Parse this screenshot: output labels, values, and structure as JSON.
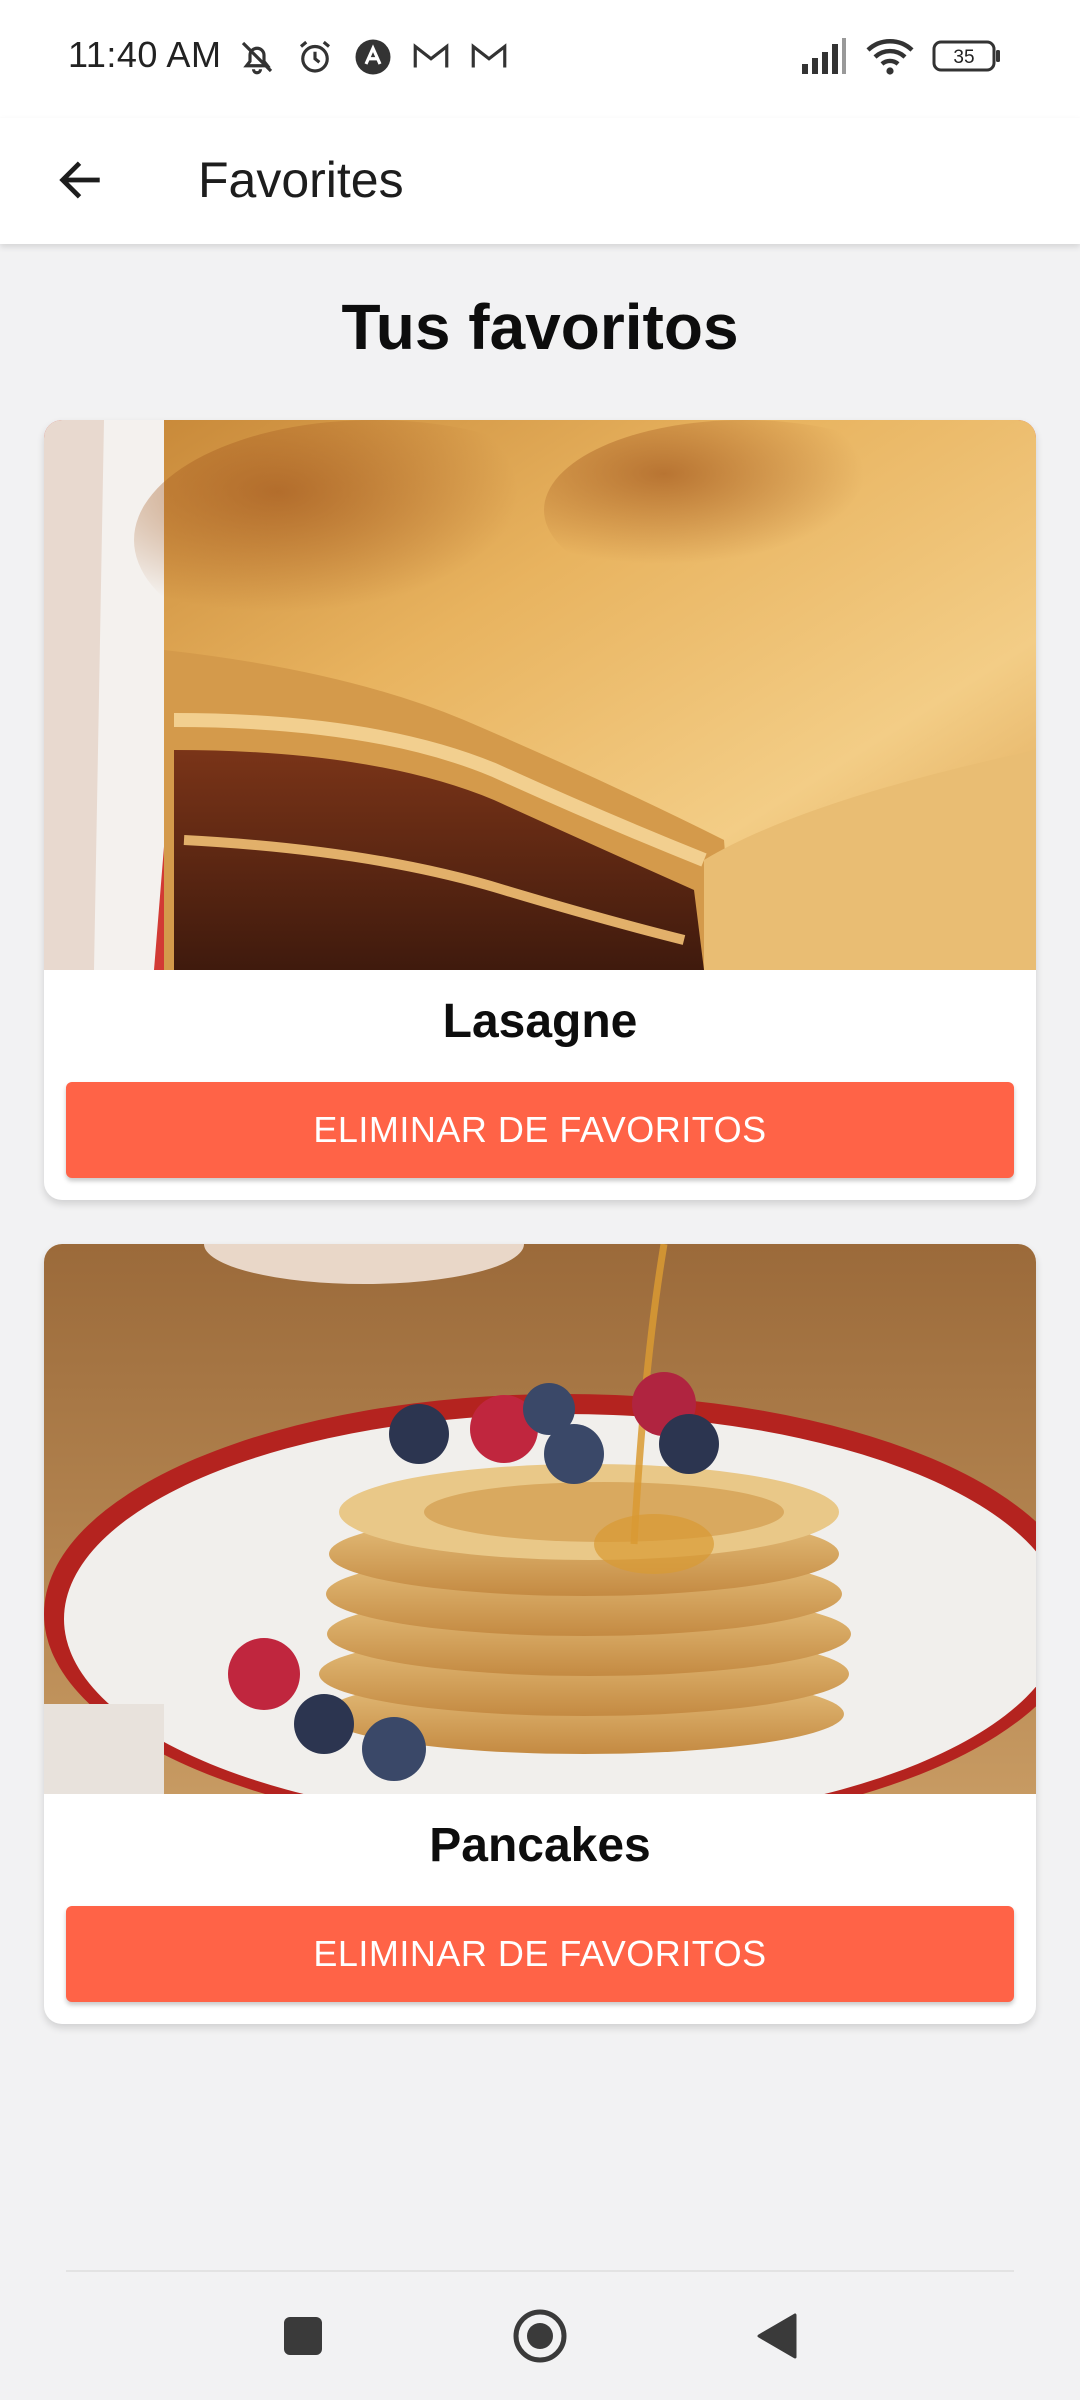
{
  "status_bar": {
    "time": "11:40 AM",
    "battery_level": "35",
    "left_icons": [
      "mute-icon",
      "alarm-icon",
      "app-icon",
      "gmail-icon",
      "gmail-icon"
    ],
    "right_icons": [
      "signal-icon",
      "wifi-icon",
      "battery-icon"
    ]
  },
  "app_bar": {
    "title": "Favorites",
    "back_icon": "arrow-left-icon"
  },
  "main": {
    "heading": "Tus favoritos",
    "favorites": [
      {
        "name": "Lasagne",
        "button_label": "ELIMINAR DE FAVORITOS",
        "image": "lasagne-photo"
      },
      {
        "name": "Pancakes",
        "button_label": "ELIMINAR DE FAVORITOS",
        "image": "pancakes-photo"
      }
    ]
  },
  "nav_bar": {
    "buttons": [
      "recents-square-icon",
      "home-circle-icon",
      "back-triangle-icon"
    ]
  },
  "colors": {
    "accent": "#ff6347",
    "background": "#f2f2f3",
    "surface": "#ffffff"
  }
}
